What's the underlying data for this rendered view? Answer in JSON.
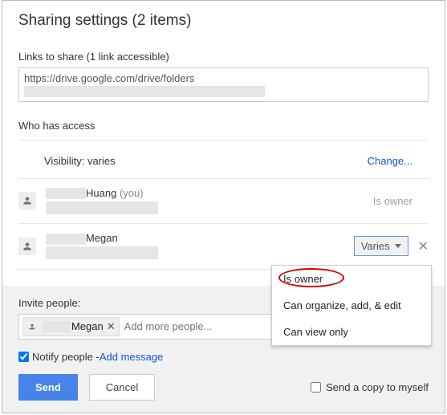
{
  "title": "Sharing settings (2 items)",
  "links": {
    "label": "Links to share (1 link accessible)",
    "url_visible": "https://drive.google.com/drive/folders"
  },
  "who": {
    "heading": "Who has access",
    "visibility_label": "Visibility: varies",
    "change": "Change..."
  },
  "users": {
    "owner": {
      "name": "Huang",
      "you": "(you)",
      "role": "Is owner"
    },
    "second": {
      "name": "Megan",
      "role": "Varies"
    }
  },
  "dropdown": {
    "opt1": "Is owner",
    "opt2": "Can organize, add, & edit",
    "opt3": "Can view only"
  },
  "invite": {
    "label": "Invite people:",
    "chip_name": "Megan",
    "placeholder": "Add more people...",
    "notify": "Notify people - ",
    "add_message": "Add message"
  },
  "buttons": {
    "send": "Send",
    "cancel": "Cancel",
    "copy": "Send a copy to myself"
  }
}
